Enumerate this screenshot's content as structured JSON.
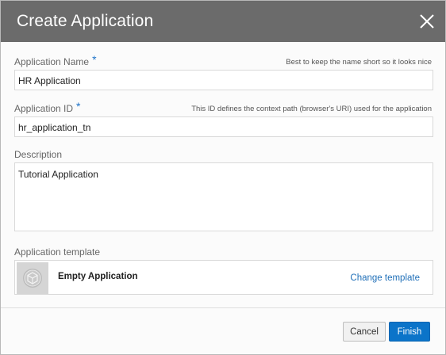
{
  "dialog": {
    "title": "Create Application",
    "close_icon": "close-icon"
  },
  "fields": {
    "app_name": {
      "label": "Application Name",
      "required_mark": "*",
      "hint": "Best to keep the name short so it looks nice",
      "value": "HR Application"
    },
    "app_id": {
      "label": "Application ID",
      "required_mark": "*",
      "hint": "This ID defines the context path (browser's URI) used for the application",
      "value": "hr_application_tn"
    },
    "description": {
      "label": "Description",
      "value": "Tutorial Application"
    },
    "template": {
      "label": "Application template",
      "name": "Empty Application",
      "change_label": "Change template",
      "thumb_icon": "cube-icon"
    }
  },
  "buttons": {
    "cancel": "Cancel",
    "finish": "Finish"
  },
  "colors": {
    "header_bg": "#6b6b6b",
    "required": "#1f73c9",
    "link": "#1f6fb8",
    "primary_button": "#0b74c9"
  }
}
